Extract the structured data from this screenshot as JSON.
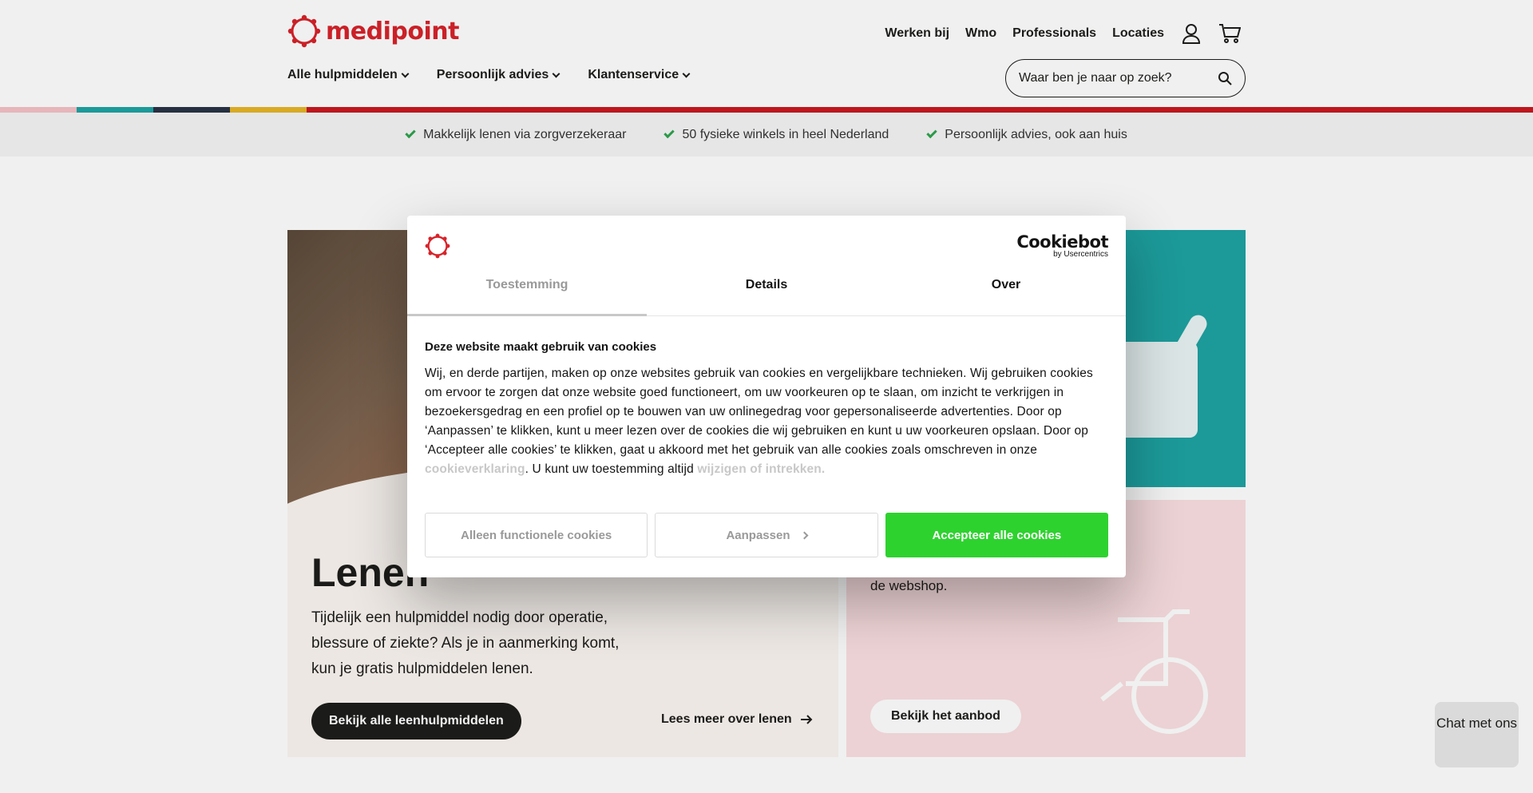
{
  "header": {
    "logo_text": "medipoint",
    "top_links": [
      "Werken bij",
      "Wmo",
      "Professionals",
      "Locaties"
    ],
    "main_nav": [
      "Alle hulpmiddelen",
      "Persoonlijk advies",
      "Klantenservice"
    ],
    "search_placeholder": "Waar ben je naar op zoek?"
  },
  "colors": {
    "brand_red": "#d8232a",
    "stripe": [
      "#f5c2c7",
      "#1ea3a3",
      "#2a3447",
      "#e6b527",
      "#c8191f"
    ],
    "accept_green": "#2ed22f"
  },
  "usps": [
    "Makkelijk lenen via zorgverzekeraar",
    "50 fysieke winkels in heel Nederland",
    "Persoonlijk advies, ook aan huis"
  ],
  "cards": {
    "lenen": {
      "title": "Lenen",
      "text": "Tijdelijk een hulpmiddel nodig door operatie, blessure of ziekte? Als je in aanmerking komt, kun je gratis hulpmiddelen lenen.",
      "button": "Bekijk alle leenhulpmiddelen",
      "link": "Lees meer over lenen"
    },
    "kopen": {
      "text": "Bekijk alle koophulpmiddelen in de webshop.",
      "button": "Bekijk het aanbod"
    }
  },
  "chat": {
    "label": "Chat met ons"
  },
  "cookie_dialog": {
    "brand": "Cookiebot",
    "brand_sub": "by Usercentrics",
    "tabs": [
      "Toestemming",
      "Details",
      "Over"
    ],
    "active_tab": "Toestemming",
    "heading": "Deze website maakt gebruik van cookies",
    "body_part1": "Wij, en derde partijen, maken op onze websites gebruik van cookies en vergelijkbare technieken. Wij gebruiken cookies om ervoor te zorgen dat onze website goed functioneert, om uw voorkeuren op te slaan, om inzicht te verkrijgen in bezoekersgedrag en een profiel op te bouwen van uw onlinegedrag voor gepersonaliseerde advertenties. Door op ‘Aanpassen’ te klikken, kunt u meer lezen over de cookies die wij gebruiken en kunt u uw voorkeuren opslaan. Door op ‘Accepteer alle cookies’ te klikken, gaat u akkoord met het gebruik van alle cookies zoals omschreven in onze ",
    "link1": "cookieverklaring",
    "body_part2": ". U kunt uw toestemming altijd ",
    "link2": "wijzigen of intrekken.",
    "buttons": {
      "functional": "Alleen functionele cookies",
      "customize": "Aanpassen",
      "accept": "Accepteer alle cookies"
    }
  }
}
